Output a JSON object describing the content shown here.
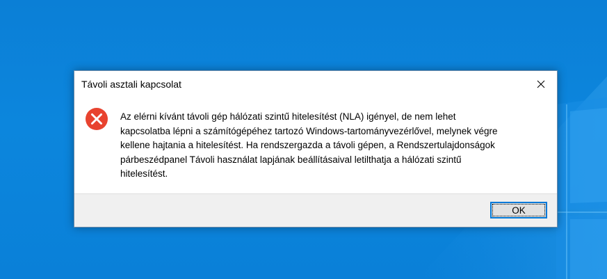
{
  "dialog": {
    "title": "Távoli asztali kapcsolat",
    "close_icon": "close-icon",
    "status_icon": "error-icon",
    "error_color": "#e8432f",
    "message_lines": [
      "Az elérni kívánt távoli gép hálózati szintű hitelesítést (NLA) igényel, de nem lehet",
      "kapcsolatba lépni a számítógépéhez tartozó Windows-tartományvezérlővel, melynek végre",
      "kellene hajtania a hitelesítést. Ha rendszergazda a távoli gépen, a Rendszertulajdonságok",
      "párbeszédpanel Távoli használat lapjának beállításaival letilthatja a hálózati szintű",
      "hitelesítést."
    ],
    "ok_label": "OK",
    "accent_color": "#0078d7"
  }
}
